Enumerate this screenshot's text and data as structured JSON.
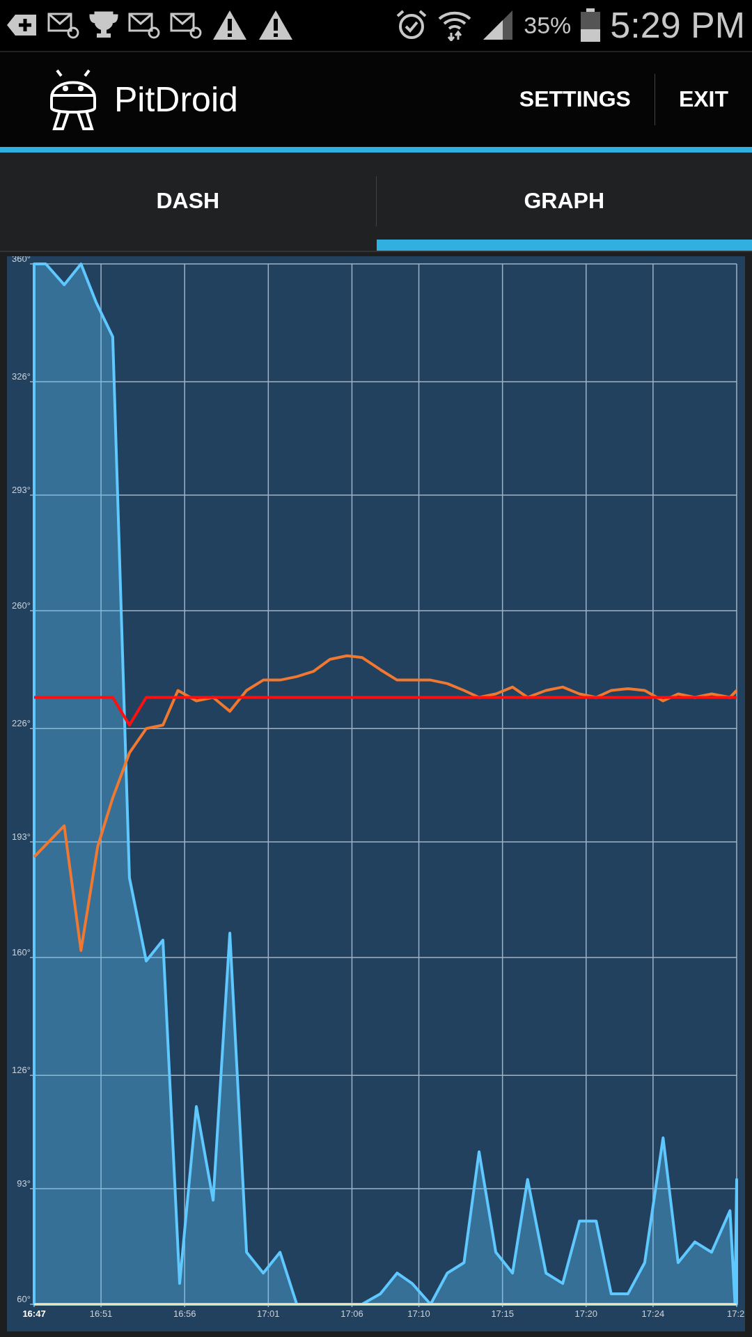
{
  "status_bar": {
    "battery_percent": "35%",
    "time": "5:29 PM"
  },
  "action_bar": {
    "title": "PitDroid",
    "actions": [
      "SETTINGS",
      "EXIT"
    ]
  },
  "tabs": [
    {
      "label": "DASH",
      "selected": false
    },
    {
      "label": "GRAPH",
      "selected": true
    }
  ],
  "graph": {
    "chart_data": {
      "type": "line",
      "grid": true,
      "xlim": [
        1007,
        1049
      ],
      "ylim": [
        60,
        360
      ],
      "xticks": [
        {
          "value": 1007,
          "label": "16:47"
        },
        {
          "value": 1011,
          "label": "16:51"
        },
        {
          "value": 1016,
          "label": "16:56"
        },
        {
          "value": 1021,
          "label": "17:01"
        },
        {
          "value": 1026,
          "label": "17:06"
        },
        {
          "value": 1030,
          "label": "17:10"
        },
        {
          "value": 1035,
          "label": "17:15"
        },
        {
          "value": 1040,
          "label": "17:20"
        },
        {
          "value": 1044,
          "label": "17:24"
        },
        {
          "value": 1049,
          "label": "17:2"
        }
      ],
      "yticks": [
        {
          "value": 60,
          "label": "60°"
        },
        {
          "value": 93.33,
          "label": "93°"
        },
        {
          "value": 126,
          "label": "126°"
        },
        {
          "value": 160,
          "label": "160°"
        },
        {
          "value": 193.33,
          "label": "193°"
        },
        {
          "value": 226,
          "label": "226°"
        },
        {
          "value": 260,
          "label": "260°"
        },
        {
          "value": 293.33,
          "label": "293°"
        },
        {
          "value": 326,
          "label": "326°"
        },
        {
          "value": 360,
          "label": "360°"
        }
      ],
      "series": [
        {
          "type": "area",
          "color": "#5ec8ff",
          "x": [
            1007,
            1007.7,
            1008.8,
            1009.8,
            1010.7,
            1011.7,
            1012.7,
            1013.7,
            1014.7,
            1015.7,
            1016.7,
            1017.7,
            1018.7,
            1019.7,
            1020.7,
            1021.7,
            1022.7,
            1026.6,
            1027.7,
            1028.7,
            1029.6,
            1030.7,
            1031.7,
            1032.7,
            1033.6,
            1034.6,
            1035.6,
            1036.5,
            1037.6,
            1038.6,
            1039.6,
            1040.6,
            1041.5,
            1042.5,
            1043.5,
            1044.6,
            1045.5,
            1046.5,
            1047.5,
            1048.6,
            1048.9,
            1049
          ],
          "values": [
            360,
            360,
            354,
            360,
            349,
            339,
            183,
            159,
            165,
            66,
            117,
            90,
            167,
            75,
            69,
            75,
            60,
            60,
            63,
            69,
            66,
            60,
            69,
            72,
            104,
            75,
            69,
            96,
            69,
            66,
            84,
            84,
            63,
            63,
            72,
            108,
            72,
            78,
            75,
            87,
            60,
            96
          ]
        },
        {
          "type": "line",
          "color": "#f07830",
          "x": [
            1007,
            1008.8,
            1009.8,
            1010.8,
            1011.7,
            1012.7,
            1013.7,
            1014.7,
            1015.6,
            1016.7,
            1017.7,
            1018.7,
            1019.7,
            1020.7,
            1021.7,
            1022.7,
            1023.7,
            1024.7,
            1025.7,
            1026.6,
            1027.7,
            1028.7,
            1029.6,
            1030.7,
            1031.7,
            1032.7,
            1033.6,
            1034.6,
            1035.6,
            1036.5,
            1037.6,
            1038.6,
            1039.6,
            1040.6,
            1041.5,
            1042.5,
            1043.5,
            1044.6,
            1045.5,
            1046.5,
            1047.5,
            1048.6,
            1049
          ],
          "values": [
            189,
            198,
            162,
            192,
            206,
            219,
            226,
            227,
            237,
            234,
            235,
            231,
            237,
            240,
            240,
            241,
            242.5,
            246,
            247,
            246.5,
            243,
            240,
            240,
            240,
            239,
            237,
            235,
            236,
            238,
            235,
            237,
            238,
            236,
            235,
            237,
            237.5,
            237,
            234,
            236,
            235,
            236,
            235,
            237
          ]
        },
        {
          "type": "line",
          "color": "#ff1010",
          "x": [
            1007,
            1011.7,
            1012.7,
            1013.7,
            1049
          ],
          "values": [
            235,
            235,
            227,
            235,
            235
          ]
        }
      ]
    }
  }
}
